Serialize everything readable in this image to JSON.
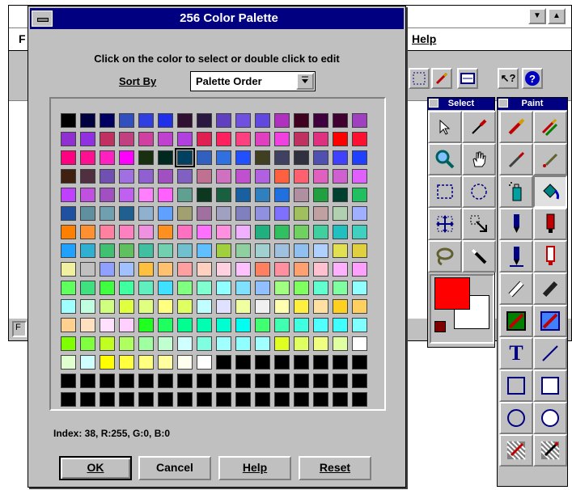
{
  "dialog": {
    "title": "256 Color Palette",
    "instruction": "Click on the color to select or double click to edit",
    "sort_label": "Sort By",
    "sort_value": "Palette Order",
    "index_text": "Index: 38, R:255, G:0, B:0",
    "buttons": {
      "ok": "OK",
      "cancel": "Cancel",
      "help": "Help",
      "reset": "Reset"
    },
    "selected_index": 38
  },
  "background_window": {
    "menu_left": "F",
    "menu_help": "Help",
    "status_left": "F"
  },
  "toolbox": {
    "select_title": "Select",
    "paint_title": "Paint"
  },
  "palette": [
    "#000000",
    "#000040",
    "#000060",
    "#3050c0",
    "#3040e0",
    "#2030e8",
    "#301030",
    "#2a1840",
    "#6040c0",
    "#7050e0",
    "#6048e0",
    "#b030c0",
    "#400020",
    "#400040",
    "#400030",
    "#a040c0",
    "#9030d0",
    "#9030e0",
    "#c03060",
    "#c04080",
    "#d040a0",
    "#c040d0",
    "#b040e0",
    "#e02050",
    "#ff2060",
    "#ff4080",
    "#e040c0",
    "#f040e0",
    "#c03060",
    "#e03080",
    "#ff0000",
    "#ff1030",
    "#ff0080",
    "#ff1090",
    "#ff20c0",
    "#ff00ff",
    "#183010",
    "#002820",
    "#004060",
    "#3060c0",
    "#3070e0",
    "#2050ff",
    "#404020",
    "#404060",
    "#303040",
    "#5050b0",
    "#4040ff",
    "#2040ff",
    "#402010",
    "#503040",
    "#7050b0",
    "#a070e0",
    "#9060d0",
    "#a050c0",
    "#8060c0",
    "#c07090",
    "#d070c0",
    "#c050d0",
    "#b060e0",
    "#ff6040",
    "#ff6070",
    "#e060c0",
    "#d060d0",
    "#e060ff",
    "#c040ff",
    "#c050e0",
    "#a050c0",
    "#c060f0",
    "#ff80ff",
    "#ff60ff",
    "#60a090",
    "#0c3820",
    "#186040",
    "#1860a0",
    "#3080c0",
    "#2070e0",
    "#b090a0",
    "#20a040",
    "#004030",
    "#20c060",
    "#2050a0",
    "#6090a0",
    "#70a0b0",
    "#206090",
    "#90b0d0",
    "#60a0ff",
    "#a0a070",
    "#a070a0",
    "#a0a0c0",
    "#8080c0",
    "#9090e0",
    "#8070ff",
    "#a0c060",
    "#c0a0a0",
    "#b0d0b0",
    "#a0b0ff",
    "#ff8000",
    "#ff9030",
    "#ff80a0",
    "#ff80c0",
    "#f090e0",
    "#ff9020",
    "#ff70c0",
    "#ff70ff",
    "#ff90e0",
    "#f0b0ff",
    "#20b080",
    "#30c060",
    "#70d060",
    "#40d0a0",
    "#20c0c0",
    "#40d0c0",
    "#20a0ff",
    "#30b0d0",
    "#40c070",
    "#60c060",
    "#40c0a0",
    "#70d0b0",
    "#70c0d0",
    "#60c0ff",
    "#a0d040",
    "#90d0a0",
    "#a0d0d0",
    "#a0c0e0",
    "#90c0f0",
    "#b0d0ff",
    "#e0e050",
    "#e0d040",
    "#f0f0a0",
    "#c0c0c0",
    "#90a0ff",
    "#a0c0ff",
    "#ffc040",
    "#ffc070",
    "#ffa0a0",
    "#ffd0c0",
    "#ffd0e0",
    "#ffc0ff",
    "#ff8060",
    "#ff90a0",
    "#ffa070",
    "#ffc0d0",
    "#ffb0ff",
    "#ffa0ff",
    "#60ff60",
    "#40e080",
    "#40ff40",
    "#40ffa0",
    "#60f0c0",
    "#40e0ff",
    "#80ff80",
    "#80ffd0",
    "#90ffff",
    "#80e0ff",
    "#90c0ff",
    "#a0ff80",
    "#80ff60",
    "#60ffd0",
    "#80ffa0",
    "#90ffff",
    "#a0ffff",
    "#c0ffe0",
    "#d0ff80",
    "#e0ff40",
    "#e0ff80",
    "#ffff80",
    "#e0ff60",
    "#c0ffff",
    "#e0e0ff",
    "#f0ffa0",
    "#f0f0f0",
    "#ffffb0",
    "#fff040",
    "#ffe0a0",
    "#ffd020",
    "#ffd060",
    "#ffd090",
    "#ffe0c0",
    "#ffe0ff",
    "#ffd0ff",
    "#20ff20",
    "#20ff60",
    "#00ff90",
    "#00ffb0",
    "#00ffd0",
    "#00fff0",
    "#40ff70",
    "#40ffb0",
    "#40ffe0",
    "#50ffff",
    "#40ffff",
    "#80ffff",
    "#80ff00",
    "#80ff40",
    "#c0ff20",
    "#b0ff60",
    "#a0ffa0",
    "#c0ffd0",
    "#d0ffff",
    "#80ffe0",
    "#a0ffff",
    "#90ffff",
    "#a0ffff",
    "#e0ff20",
    "#e0ff60",
    "#f0ff80",
    "#e0ffa0",
    "#ffffff",
    "#e0ffd0",
    "#d0ffff",
    "#ffff00",
    "#ffff40",
    "#ffff80",
    "#ffffa0",
    "#fffff0",
    "#ffffff",
    "#000000",
    "#000000",
    "#000000",
    "#000000",
    "#000000",
    "#000000",
    "#000000",
    "#000000",
    "#000000",
    "#000000",
    "#000000",
    "#000000",
    "#000000",
    "#000000",
    "#000000",
    "#000000",
    "#000000",
    "#000000",
    "#000000",
    "#000000",
    "#000000",
    "#000000",
    "#000000",
    "#000000",
    "#000000",
    "#000000",
    "#000000",
    "#000000",
    "#000000",
    "#000000",
    "#000000",
    "#000000",
    "#000000",
    "#000000",
    "#000000",
    "#000000",
    "#000000",
    "#000000",
    "#000000",
    "#000000"
  ],
  "colors": {
    "title_bar": "#000080",
    "face": "#c0c0c0",
    "foreground_color": "#ff0000",
    "background_color": "#ffffff"
  }
}
